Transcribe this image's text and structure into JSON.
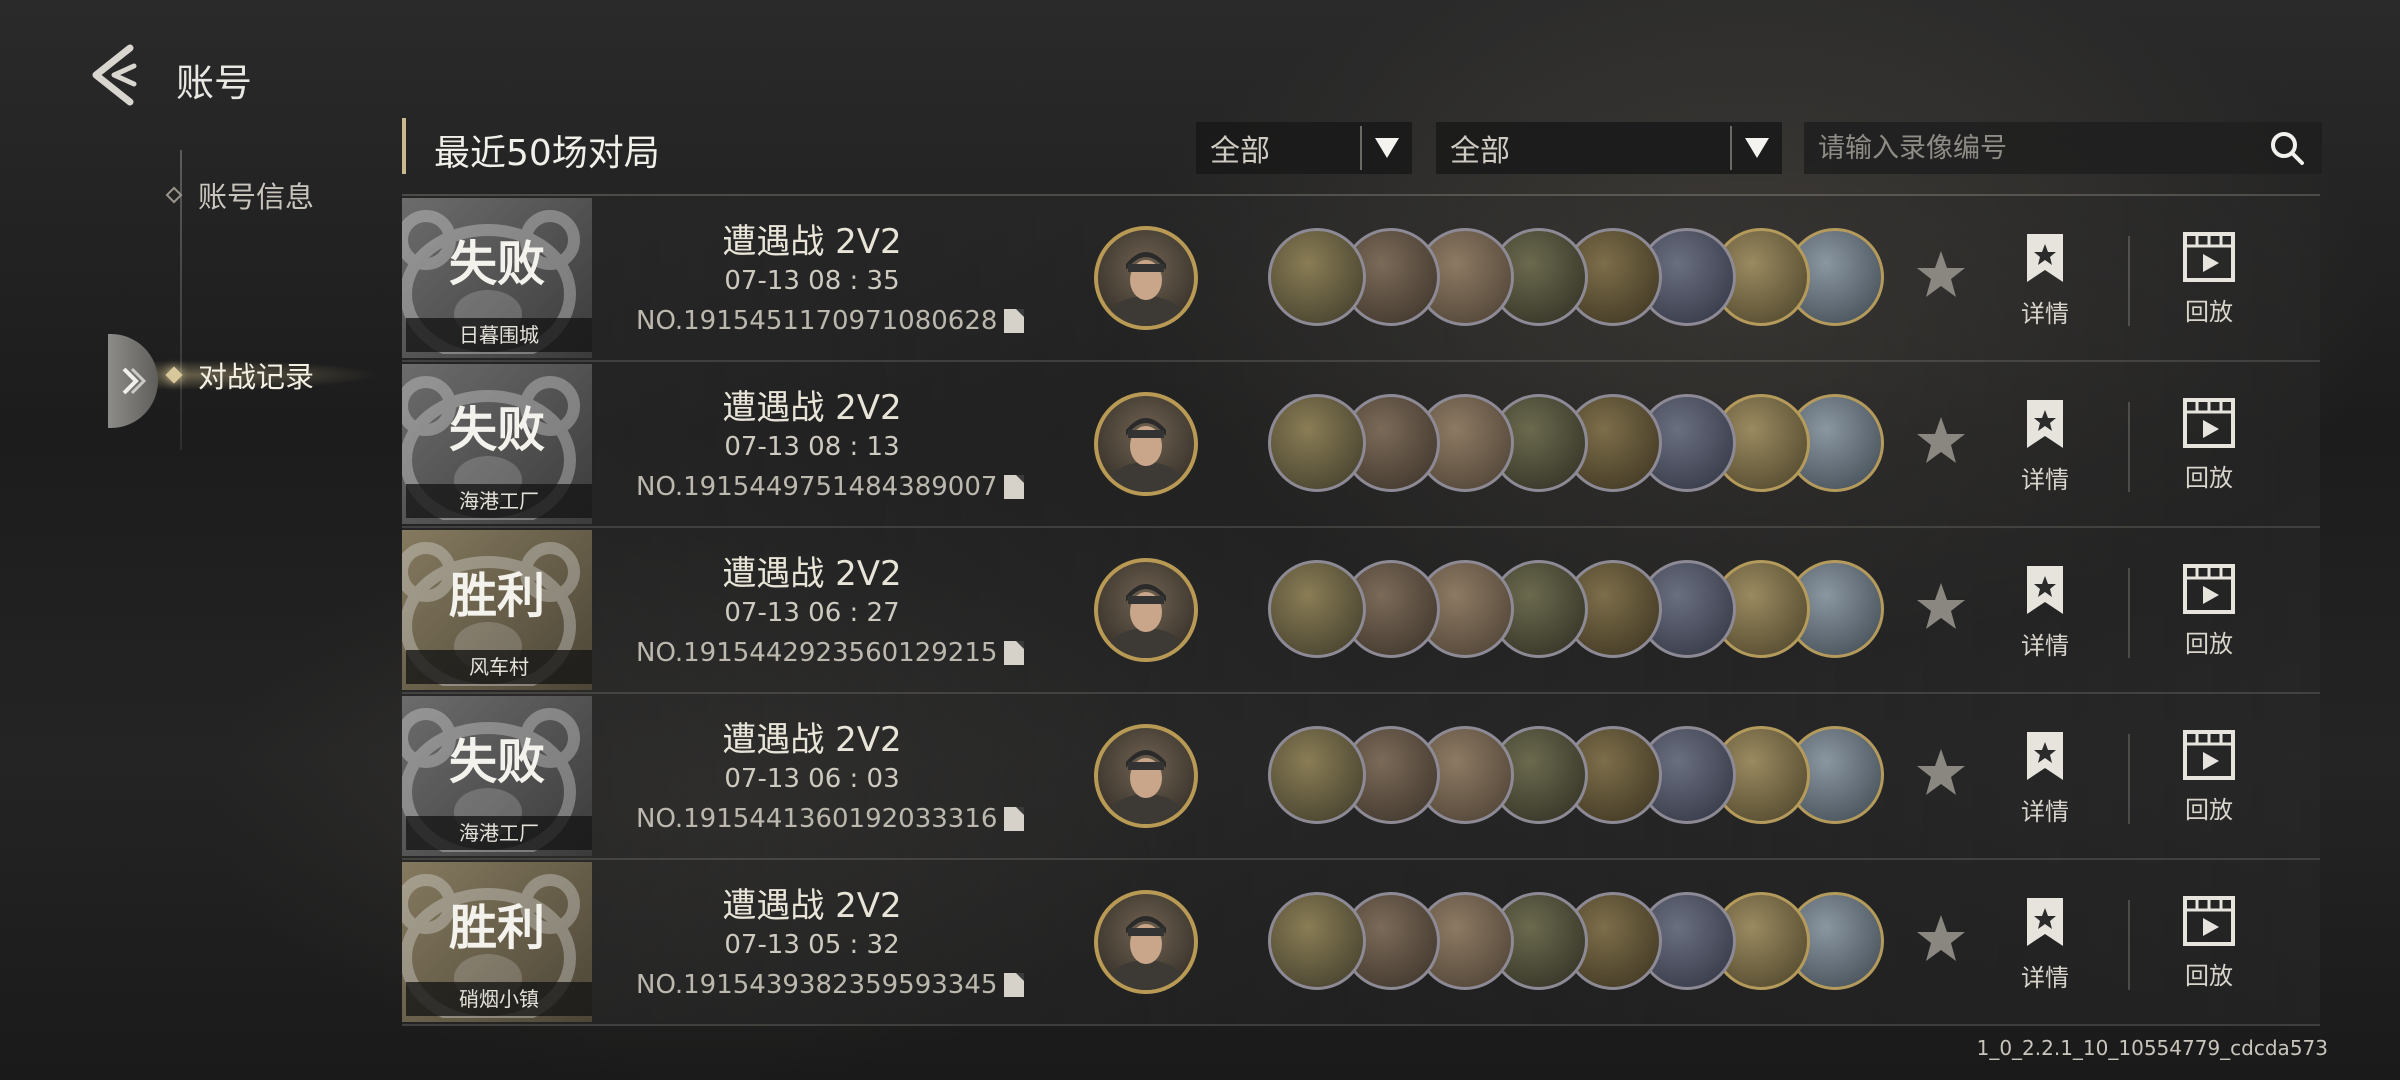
{
  "header": {
    "title": "账号"
  },
  "sidebar": {
    "items": [
      {
        "label": "账号信息",
        "active": false
      },
      {
        "label": "对战记录",
        "active": true
      }
    ]
  },
  "main": {
    "section_title": "最近50场对局",
    "filters": [
      {
        "selected": "全部"
      },
      {
        "selected": "全部"
      }
    ],
    "search": {
      "placeholder": "请输入录像编号"
    },
    "actions": {
      "detail": "详情",
      "replay": "回放"
    },
    "matches": [
      {
        "result": "失败",
        "outcome": "lose",
        "map": "日暮围城",
        "mode": "遭遇战 2V2",
        "time": "07-13  08 : 35",
        "record_no": "NO.1915451170971080628"
      },
      {
        "result": "失败",
        "outcome": "lose",
        "map": "海港工厂",
        "mode": "遭遇战 2V2",
        "time": "07-13  08 : 13",
        "record_no": "NO.1915449751484389007"
      },
      {
        "result": "胜利",
        "outcome": "win",
        "map": "风车村",
        "mode": "遭遇战 2V2",
        "time": "07-13  06 : 27",
        "record_no": "NO.1915442923560129215"
      },
      {
        "result": "失败",
        "outcome": "lose",
        "map": "海港工厂",
        "mode": "遭遇战 2V2",
        "time": "07-13  06 : 03",
        "record_no": "NO.1915441360192033316"
      },
      {
        "result": "胜利",
        "outcome": "win",
        "map": "硝烟小镇",
        "mode": "遭遇战 2V2",
        "time": "07-13  05 : 32",
        "record_no": "NO.1915439382359593345"
      }
    ]
  },
  "colors": {
    "accent_gold": "#c8b98f",
    "lose_card": "#5a5a5a",
    "win_card": "#7a6f55"
  },
  "version": "1_0_2.2.1_10_10554779_cdcda573"
}
